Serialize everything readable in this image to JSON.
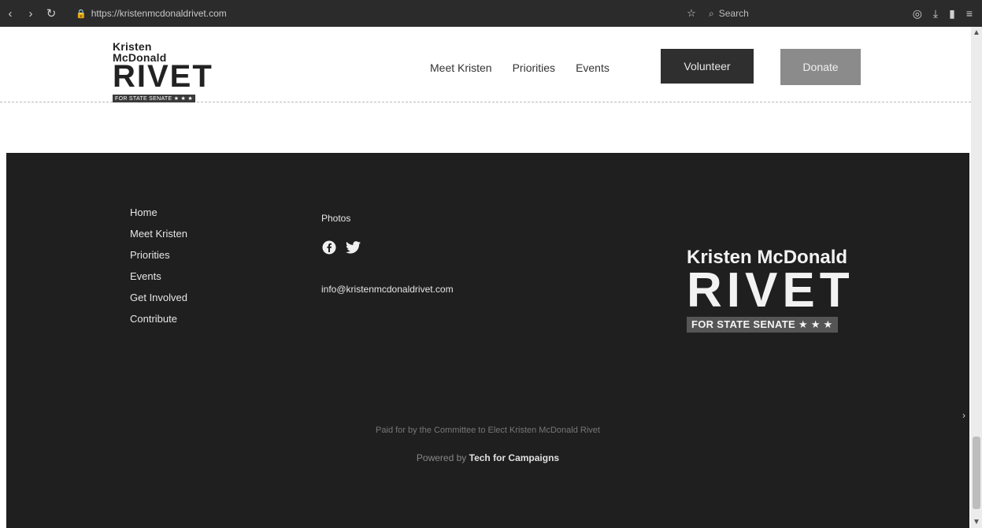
{
  "browser": {
    "url": "https://kristenmcdonaldrivet.com",
    "search_placeholder": "Search"
  },
  "header": {
    "logo_name": "Kristen McDonald",
    "logo_big": "RIVET",
    "logo_tag": "FOR STATE SENATE ★ ★ ★",
    "nav": [
      "Meet Kristen",
      "Priorities",
      "Events"
    ],
    "volunteer_label": "Volunteer",
    "donate_label": "Donate"
  },
  "footer": {
    "links": [
      "Home",
      "Meet Kristen",
      "Priorities",
      "Events",
      "Get Involved",
      "Contribute"
    ],
    "photos_label": "Photos",
    "email": "info@kristenmcdonaldrivet.com",
    "logo_name": "Kristen McDonald",
    "logo_big": "RIVET",
    "logo_tag": "FOR STATE SENATE ★ ★ ★",
    "paid_for": "Paid for by the Committee to Elect Kristen McDonald Rivet",
    "powered_prefix": "Powered by",
    "powered_brand": "Tech for Campaigns"
  }
}
